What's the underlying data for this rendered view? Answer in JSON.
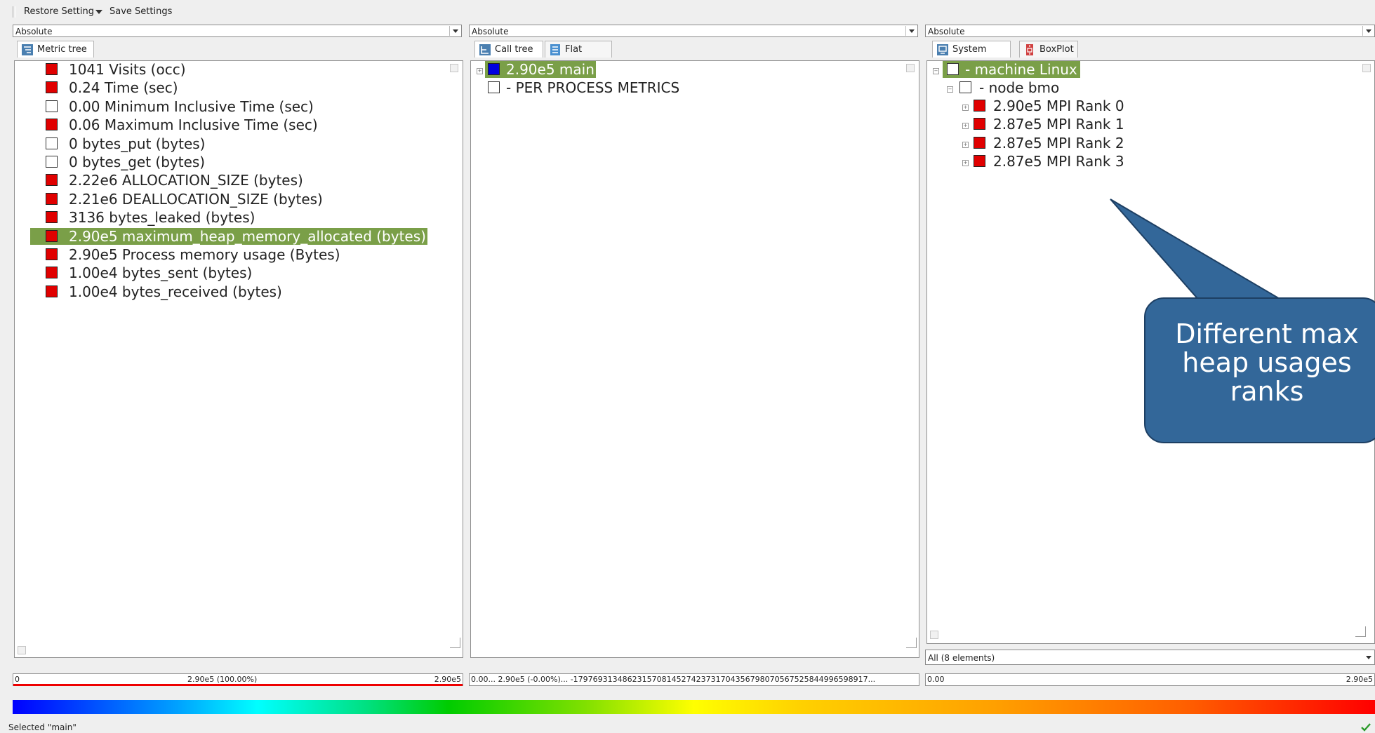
{
  "toolbar": {
    "restore_label": "Restore Setting",
    "save_label": "Save Settings"
  },
  "left": {
    "mode": "Absolute",
    "tab": "Metric tree",
    "items": [
      {
        "value": "1041",
        "label": "Visits (occ)",
        "box": "red"
      },
      {
        "value": "0.24",
        "label": "Time (sec)",
        "box": "red"
      },
      {
        "value": "0.00",
        "label": "Minimum Inclusive Time (sec)",
        "box": "white"
      },
      {
        "value": "0.06",
        "label": "Maximum Inclusive Time (sec)",
        "box": "red"
      },
      {
        "value": "0",
        "label": "bytes_put (bytes)",
        "box": "white"
      },
      {
        "value": "0",
        "label": "bytes_get (bytes)",
        "box": "white"
      },
      {
        "value": "2.22e6",
        "label": "ALLOCATION_SIZE (bytes)",
        "box": "red"
      },
      {
        "value": "2.21e6",
        "label": "DEALLOCATION_SIZE (bytes)",
        "box": "red"
      },
      {
        "value": "3136",
        "label": "bytes_leaked (bytes)",
        "box": "red"
      },
      {
        "value": "2.90e5",
        "label": "maximum_heap_memory_allocated (bytes)",
        "box": "red",
        "selected": true
      },
      {
        "value": "2.90e5",
        "label": "Process memory usage (Bytes)",
        "box": "red"
      },
      {
        "value": "1.00e4",
        "label": "bytes_sent (bytes)",
        "box": "red"
      },
      {
        "value": "1.00e4",
        "label": "bytes_received (bytes)",
        "box": "red"
      }
    ],
    "scale_min": "0",
    "scale_mid": "2.90e5 (100.00%)",
    "scale_max": "2.90e5"
  },
  "middle": {
    "mode": "Absolute",
    "tabs": [
      "Call tree",
      "Flat view"
    ],
    "items": [
      {
        "value": "2.90e5",
        "label": "main",
        "box": "blue",
        "selected": true
      },
      {
        "value": "-",
        "label": "PER PROCESS METRICS",
        "box": "white"
      }
    ],
    "scale_text": "0.00... 2.90e5 (-0.00%)... -179769313486231570814527423731704356798070567525844996598917..."
  },
  "right": {
    "mode": "Absolute",
    "tabs": [
      "System tree",
      "BoxPlot"
    ],
    "machine": {
      "value": "-",
      "label": "machine Linux"
    },
    "node": {
      "value": "-",
      "label": "node bmo"
    },
    "ranks": [
      {
        "value": "2.90e5",
        "label": "MPI Rank 0"
      },
      {
        "value": "2.87e5",
        "label": "MPI Rank 1"
      },
      {
        "value": "2.87e5",
        "label": "MPI Rank 2"
      },
      {
        "value": "2.87e5",
        "label": "MPI Rank 3"
      }
    ],
    "filter": "All (8 elements)",
    "scale_min": "0.00",
    "scale_max": "2.90e5"
  },
  "callout": {
    "lines": [
      "Different max",
      "heap usages",
      "ranks"
    ]
  },
  "status": {
    "text": "Selected \"main\""
  },
  "colors": {
    "selection": "#7a9f48",
    "callout": "#336799"
  }
}
